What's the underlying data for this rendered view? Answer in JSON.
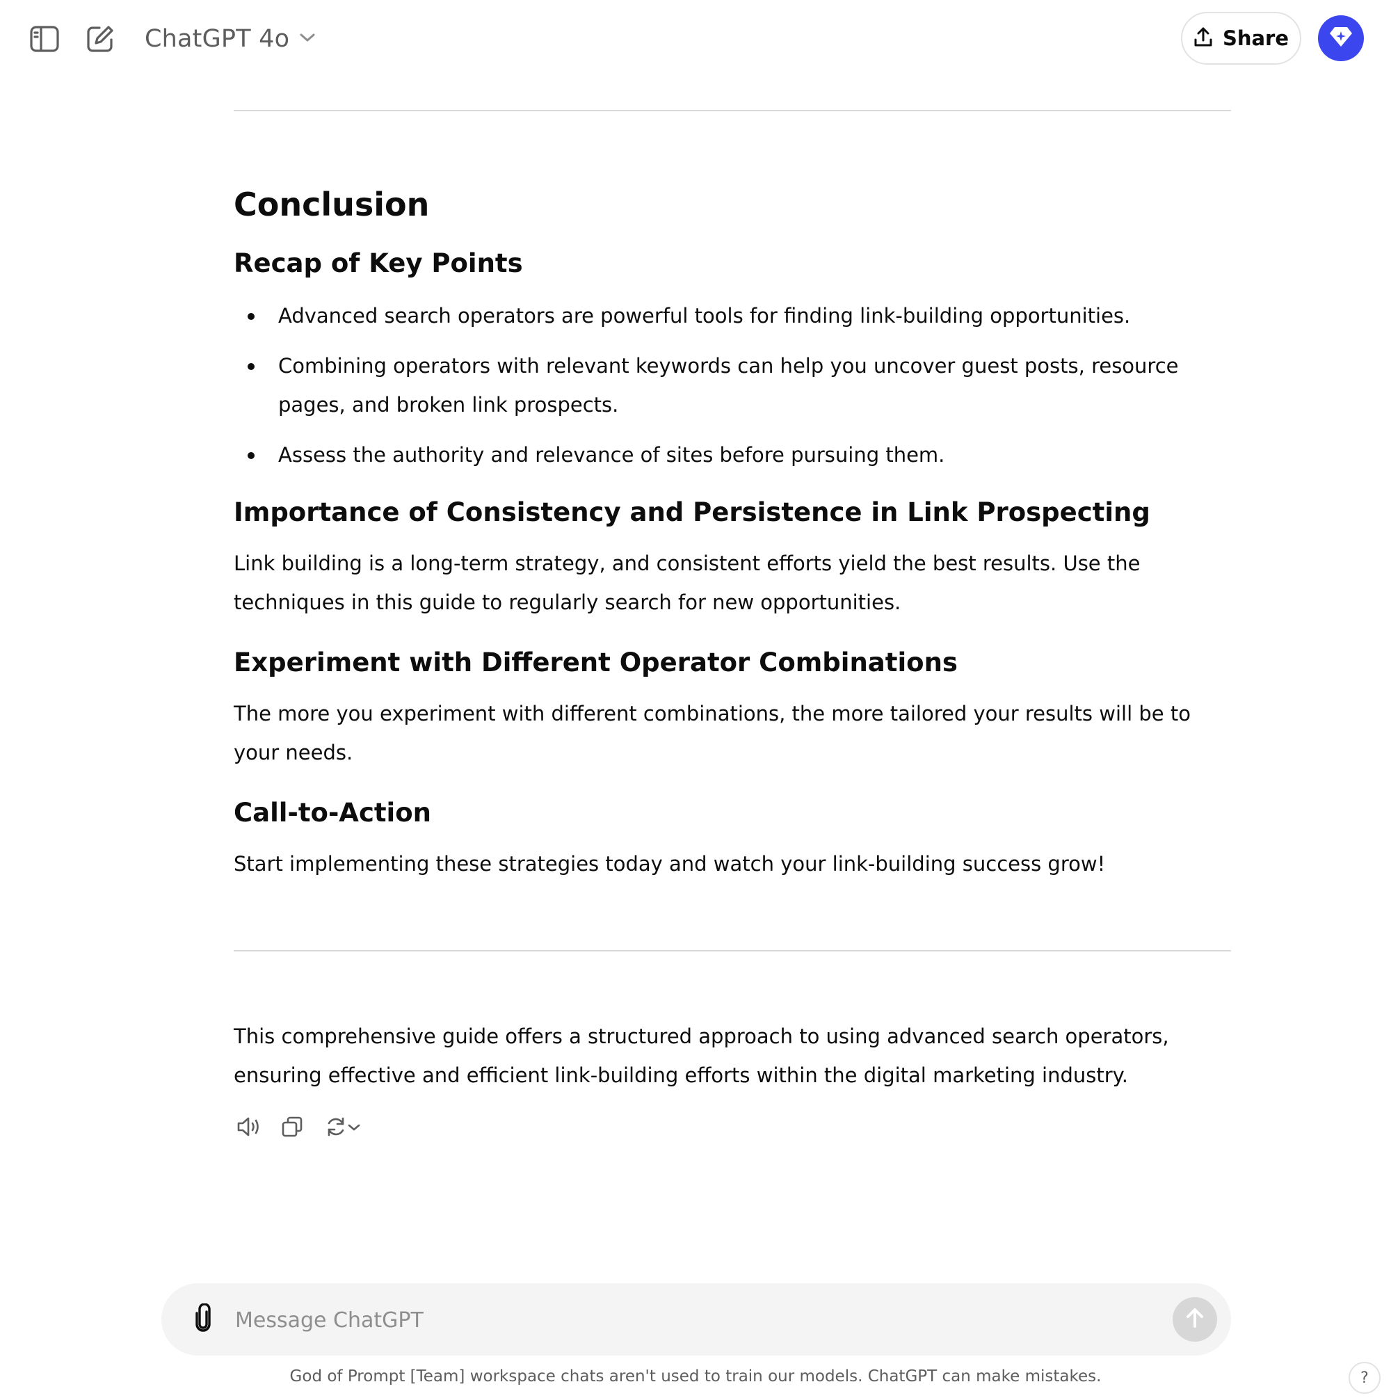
{
  "header": {
    "model_label": "ChatGPT 4o",
    "share_label": "Share"
  },
  "conclusion": {
    "title": "Conclusion",
    "recap_heading": "Recap of Key Points",
    "points": [
      "Advanced search operators are powerful tools for finding link-building opportunities.",
      "Combining operators with relevant keywords can help you uncover guest posts, resource pages, and broken link prospects.",
      "Assess the authority and relevance of sites before pursuing them."
    ],
    "sections": [
      {
        "heading": "Importance of Consistency and Persistence in Link Prospecting",
        "body": "Link building is a long-term strategy, and consistent efforts yield the best results. Use the techniques in this guide to regularly search for new opportunities."
      },
      {
        "heading": "Experiment with Different Operator Combinations",
        "body": "The more you experiment with different combinations, the more tailored your results will be to your needs."
      },
      {
        "heading": "Call-to-Action",
        "body": "Start implementing these strategies today and watch your link-building success grow!"
      }
    ]
  },
  "closing_paragraph": "This comprehensive guide offers a structured approach to using advanced search operators, ensuring effective and efficient link-building efforts within the digital marketing industry.",
  "composer": {
    "placeholder": "Message ChatGPT"
  },
  "footer": {
    "note": "God of Prompt [Team] workspace chats aren't used to train our models. ChatGPT can make mistakes.",
    "help": "?"
  },
  "colors": {
    "avatar_bg": "#3b46ee",
    "send_disabled": "#d7d7d7",
    "composer_bg": "#f4f4f4"
  }
}
